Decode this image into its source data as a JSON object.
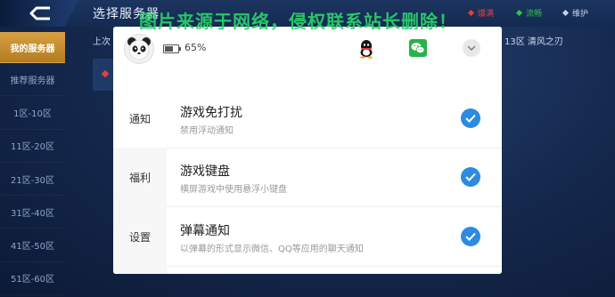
{
  "header": {
    "title": "选择服务器",
    "legend": [
      {
        "label": "爆满",
        "color": "#e2423a"
      },
      {
        "label": "流畅",
        "color": "#35c24a"
      },
      {
        "label": "维护",
        "color": "#c9d3e6"
      }
    ],
    "watermark": "图片来源于网络，侵权联系站长删除！"
  },
  "sidebar": {
    "items": [
      {
        "label": "我的服务器",
        "active": true
      },
      {
        "label": "推荐服务器"
      },
      {
        "label": "1区-10区"
      },
      {
        "label": "11区-20区"
      },
      {
        "label": "21区-30区"
      },
      {
        "label": "31区-40区"
      },
      {
        "label": "41区-50区"
      },
      {
        "label": "51区-60区"
      }
    ]
  },
  "background": {
    "recent_label": "上次",
    "recent_server": "13区 清风之刃"
  },
  "modal": {
    "battery": "65%",
    "battery_level": 0.65,
    "icons": [
      "qq-icon",
      "wechat-icon",
      "chevron-down-icon"
    ],
    "tabs": [
      {
        "label": "通知",
        "active": true
      },
      {
        "label": "福利"
      },
      {
        "label": "设置"
      }
    ],
    "options": [
      {
        "title": "游戏免打扰",
        "subtitle": "禁用浮动通知",
        "checked": true
      },
      {
        "title": "游戏键盘",
        "subtitle": "横屏游戏中使用悬浮小键盘",
        "checked": true
      },
      {
        "title": "弹幕通知",
        "subtitle": "以弹幕的形式显示微信、QQ等应用的聊天通知",
        "checked": true
      }
    ]
  }
}
